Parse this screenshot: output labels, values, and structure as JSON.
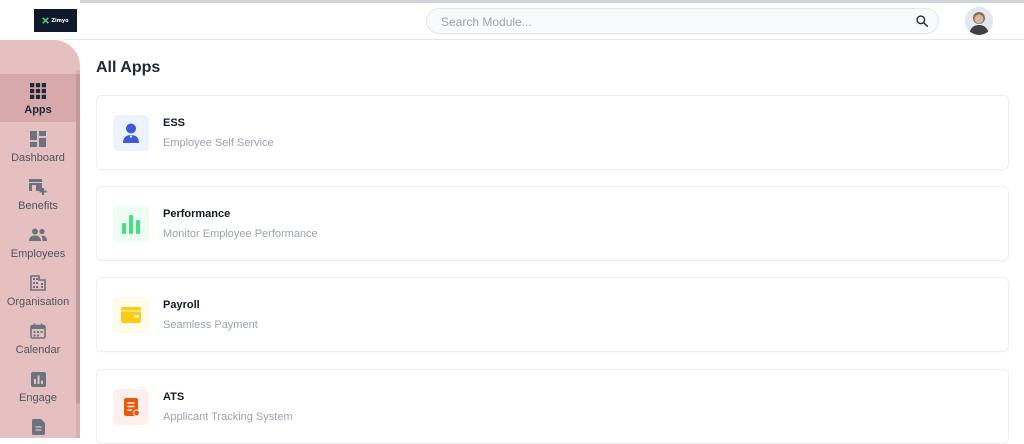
{
  "header": {
    "logo_text": "Zimyo",
    "search": {
      "placeholder": "Search Module..."
    }
  },
  "sidebar": {
    "items": [
      {
        "label": "Apps",
        "icon": "grid-icon",
        "active": true
      },
      {
        "label": "Dashboard",
        "icon": "dashboard-icon"
      },
      {
        "label": "Benefits",
        "icon": "benefits-icon"
      },
      {
        "label": "Employees",
        "icon": "employees-icon"
      },
      {
        "label": "Organisation",
        "icon": "organisation-icon"
      },
      {
        "label": "Calendar",
        "icon": "calendar-icon"
      },
      {
        "label": "Engage",
        "icon": "engage-icon"
      }
    ]
  },
  "main": {
    "title": "All Apps",
    "apps": [
      {
        "title": "ESS",
        "subtitle": "Employee Self Service",
        "icon": "person-icon",
        "color": "#3b5bdb"
      },
      {
        "title": "Performance",
        "subtitle": "Monitor Employee Performance",
        "icon": "bar-chart-icon",
        "color": "#4ade80"
      },
      {
        "title": "Payroll",
        "subtitle": "Seamless Payment",
        "icon": "wallet-icon",
        "color": "#facc15"
      },
      {
        "title": "ATS",
        "subtitle": "Applicant Tracking System",
        "icon": "document-icon",
        "color": "#e8590c"
      }
    ]
  },
  "colors": {
    "sidebar_bg": "#e6c0c0",
    "sidebar_active": "#d8a9aa",
    "logo_bg": "#0e1a2b"
  }
}
